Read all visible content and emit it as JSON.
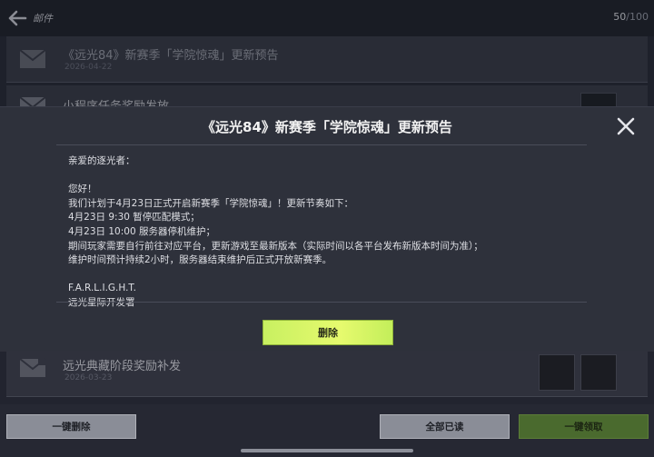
{
  "header": {
    "title": "邮件",
    "count_current": "50",
    "count_total": "/100"
  },
  "mails": [
    {
      "title": "《远光84》新赛季「学院惊魂」更新预告",
      "date": "2026-04-22"
    },
    {
      "title": "小程序任务奖励发放",
      "date": ""
    },
    {
      "title": "远光典藏阶段奖励补发",
      "date": "2026-03-23"
    }
  ],
  "dialog": {
    "title": "《远光84》新赛季「学院惊魂」更新预告",
    "body": "亲爱的逐光者：\n\n您好！\n我们计划于4月23日正式开启新赛季「学院惊魂」！更新节奏如下：\n4月23日 9:30 暂停匹配模式；\n4月23日 10:00 服务器停机维护；\n期间玩家需要自行前往对应平台，更新游戏至最新版本（实际时间以各平台发布新版本时间为准）；\n维护时间预计持续2小时，服务器结束维护后正式开放新赛季。\n\nF.A.R.L.I.G.H.T.\n远光星际开发署",
    "delete_label": "删除"
  },
  "footer": {
    "delete_all_label": "一键删除",
    "read_all_label": "全部已读",
    "claim_all_label": "一键领取"
  },
  "colors": {
    "accent_green": "#d6f566",
    "panel": "#2e313b"
  }
}
